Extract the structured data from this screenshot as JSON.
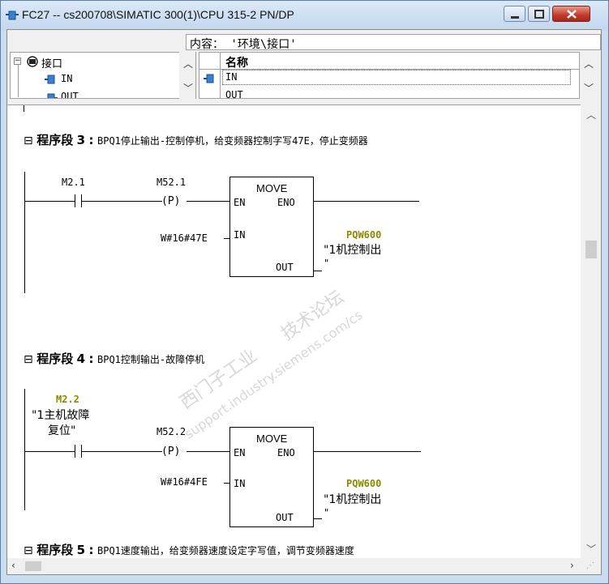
{
  "window": {
    "title": "FC27 -- cs200708\\SIMATIC 300(1)\\CPU 315-2 PN/DP"
  },
  "header": {
    "content_path": "内容： '环境\\接口'"
  },
  "tree": {
    "root": "接口",
    "items": [
      "IN",
      "OUT"
    ]
  },
  "grid": {
    "column": "名称",
    "rows": [
      "IN",
      "OUT"
    ]
  },
  "networks": [
    {
      "prefix": "程序段",
      "number": "3",
      "comment": "BPQ1停止输出-控制停机，给变频器控制字写47E，停止变频器",
      "contact": "M2.1",
      "pcoil_addr": "M52.1",
      "pcoil": "(P)",
      "block": "MOVE",
      "en": "EN",
      "eno": "ENO",
      "in_label": "IN",
      "out_label": "OUT",
      "in_value": "W#16#47E",
      "out_addr": "PQW600",
      "out_symbol": "\"1机控制出",
      "out_symbol2": "\""
    },
    {
      "prefix": "程序段",
      "number": "4",
      "comment": "BPQ1控制输出-故障停机",
      "contact": "M2.2",
      "contact_symbol1": "\"1主机故障",
      "contact_symbol2": "复位\"",
      "pcoil_addr": "M52.2",
      "pcoil": "(P)",
      "block": "MOVE",
      "en": "EN",
      "eno": "ENO",
      "in_label": "IN",
      "out_label": "OUT",
      "in_value": "W#16#4FE",
      "out_addr": "PQW600",
      "out_symbol": "\"1机控制出",
      "out_symbol2": "\""
    },
    {
      "prefix": "程序段",
      "number": "5",
      "comment": "BPQ1速度输出，给变频器速度设定字写值，调节变频器速度"
    }
  ],
  "watermark": {
    "line1": "西门子工业",
    "line2": "support.industry.siemens.com/cs",
    "line3": "技术论坛"
  },
  "colors": {
    "accent_address": "#8a8a00",
    "titlebar": "#c9dcf0",
    "close": "#c0392b"
  }
}
